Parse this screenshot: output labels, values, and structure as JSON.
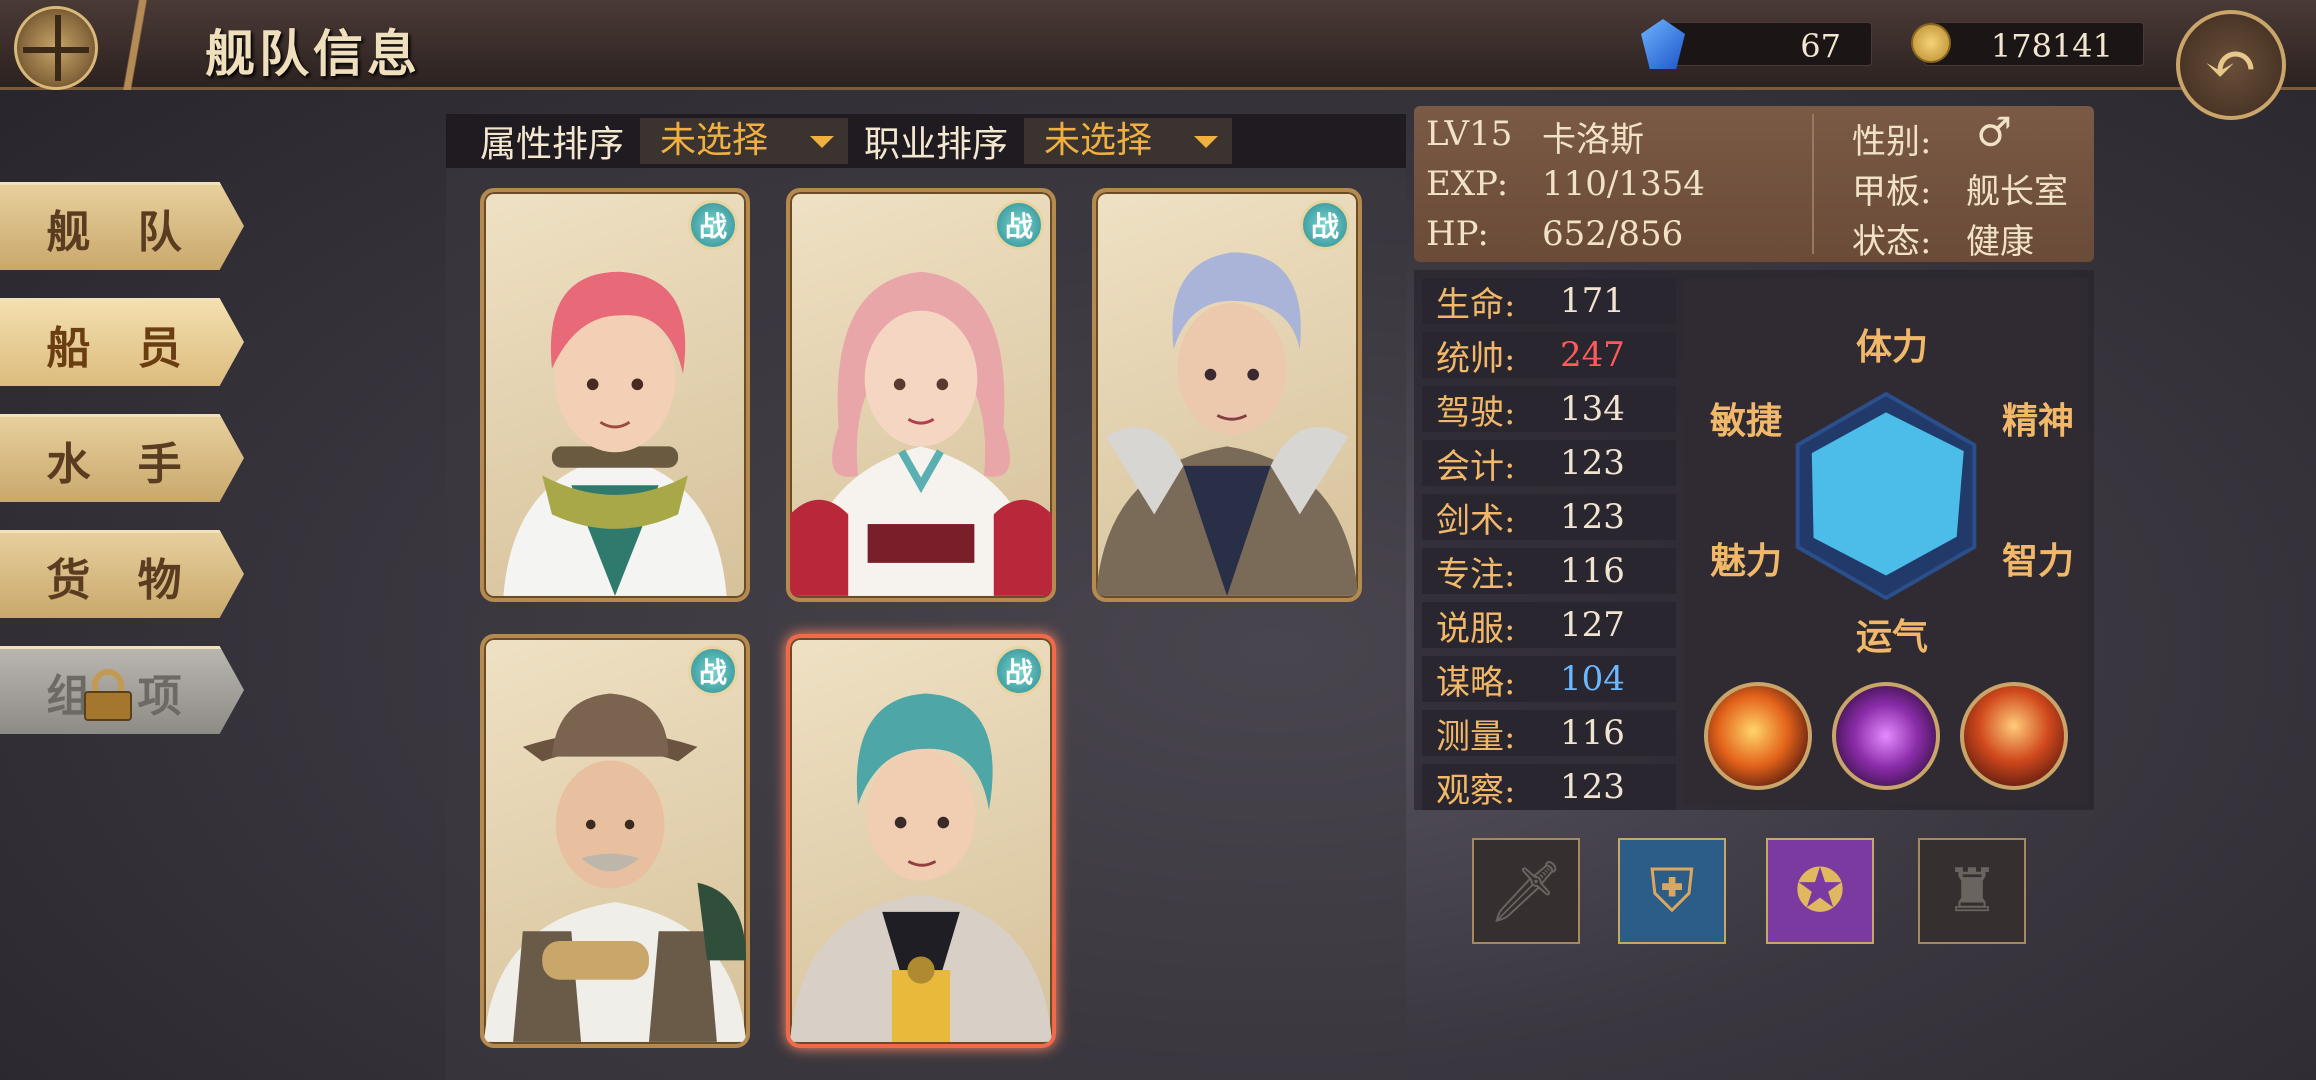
{
  "header": {
    "title": "舰队信息",
    "gems": "67",
    "gold": "178141"
  },
  "nav": [
    {
      "label": "舰 队",
      "state": "normal"
    },
    {
      "label": "船 员",
      "state": "active"
    },
    {
      "label": "水 手",
      "state": "normal"
    },
    {
      "label": "货 物",
      "state": "normal"
    },
    {
      "label": "组 项",
      "state": "locked"
    }
  ],
  "sort": {
    "attr_label": "属性排序",
    "attr_value": "未选择",
    "job_label": "职业排序",
    "job_value": "未选择"
  },
  "roster": {
    "badge": "战",
    "cards": [
      {
        "name": "pink-hair-goggles",
        "selected": false
      },
      {
        "name": "pink-hair-lady",
        "selected": false
      },
      {
        "name": "silver-hair-captain",
        "selected": false
      },
      {
        "name": "explorer-hat",
        "selected": false
      },
      {
        "name": "teal-hair-officer",
        "selected": true
      }
    ]
  },
  "character": {
    "level": "LV15",
    "name": "卡洛斯",
    "exp_label": "EXP:",
    "exp": "110/1354",
    "hp_label": "HP:",
    "hp": "652/856",
    "gender_label": "性别:",
    "gender": "♂",
    "deck_label": "甲板:",
    "deck": "舰长室",
    "status_label": "状态:",
    "status": "健康"
  },
  "stats": [
    {
      "label": "生命:",
      "value": "171",
      "color": "#f0e4d0"
    },
    {
      "label": "统帅:",
      "value": "247",
      "color": "#ff5a5a"
    },
    {
      "label": "驾驶:",
      "value": "134",
      "color": "#f0e4d0"
    },
    {
      "label": "会计:",
      "value": "123",
      "color": "#f0e4d0"
    },
    {
      "label": "剑术:",
      "value": "123",
      "color": "#f0e4d0"
    },
    {
      "label": "专注:",
      "value": "116",
      "color": "#f0e4d0"
    },
    {
      "label": "说服:",
      "value": "127",
      "color": "#f0e4d0"
    },
    {
      "label": "谋略:",
      "value": "104",
      "color": "#6ab8ff"
    },
    {
      "label": "测量:",
      "value": "116",
      "color": "#f0e4d0"
    },
    {
      "label": "观察:",
      "value": "123",
      "color": "#f0e4d0"
    }
  ],
  "radar": {
    "axes": [
      "体力",
      "精神",
      "智力",
      "运气",
      "魅力",
      "敏捷"
    ],
    "values": [
      0.82,
      0.88,
      0.8,
      0.78,
      0.82,
      0.84
    ],
    "fill": "#4bbde8",
    "grid": "#2a4f8a"
  },
  "skills": [
    "fire-burst-skill",
    "purple-beast-skill",
    "flame-fist-skill"
  ],
  "equipment": [
    {
      "slot": "weapon",
      "filled": false,
      "icon": "sword-icon"
    },
    {
      "slot": "armor",
      "filled": true,
      "icon": "leg-armor-icon"
    },
    {
      "slot": "book",
      "filled": true,
      "icon": "spellbook-icon"
    },
    {
      "slot": "accessory",
      "filled": false,
      "icon": "trophy-icon"
    }
  ]
}
